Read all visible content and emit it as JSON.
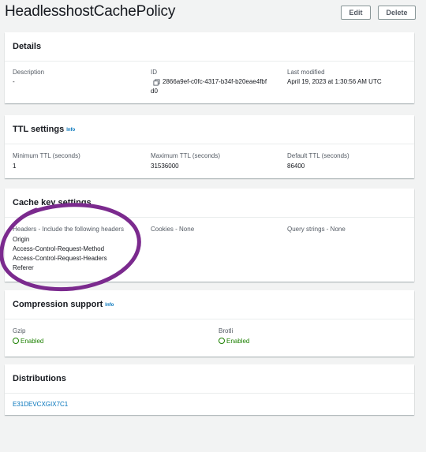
{
  "page": {
    "title": "HeadlesshostCachePolicy",
    "edit_label": "Edit",
    "delete_label": "Delete"
  },
  "details": {
    "heading": "Details",
    "description_label": "Description",
    "description_value": "-",
    "id_label": "ID",
    "id_value_line1": "2866a9ef-c0fc-4317-b34f-b20eae4fbf",
    "id_value_line2": "d0",
    "modified_label": "Last modified",
    "modified_value": "April 19, 2023 at 1:30:56 AM UTC"
  },
  "ttl": {
    "heading": "TTL settings",
    "info": "Info",
    "min_label": "Minimum TTL (seconds)",
    "min_value": "1",
    "max_label": "Maximum TTL (seconds)",
    "max_value": "31536000",
    "default_label": "Default TTL (seconds)",
    "default_value": "86400"
  },
  "cache_key": {
    "heading": "Cache key settings",
    "headers_label": "Headers - Include the following headers",
    "headers": [
      "Origin",
      "Access-Control-Request-Method",
      "Access-Control-Request-Headers",
      "Referer"
    ],
    "cookies_label": "Cookies - None",
    "query_label": "Query strings - None"
  },
  "compression": {
    "heading": "Compression support",
    "info": "Info",
    "gzip_label": "Gzip",
    "gzip_status": "Enabled",
    "brotli_label": "Brotli",
    "brotli_status": "Enabled",
    "status_color": "#1d8102"
  },
  "distributions": {
    "heading": "Distributions",
    "items": [
      "E31DEVCXGIX7C1"
    ]
  },
  "colors": {
    "background": "#f2f3f3",
    "link": "#0073bb",
    "annotation": "#7b2a8e"
  },
  "icons": [
    "copy-icon",
    "check-circle-icon"
  ]
}
